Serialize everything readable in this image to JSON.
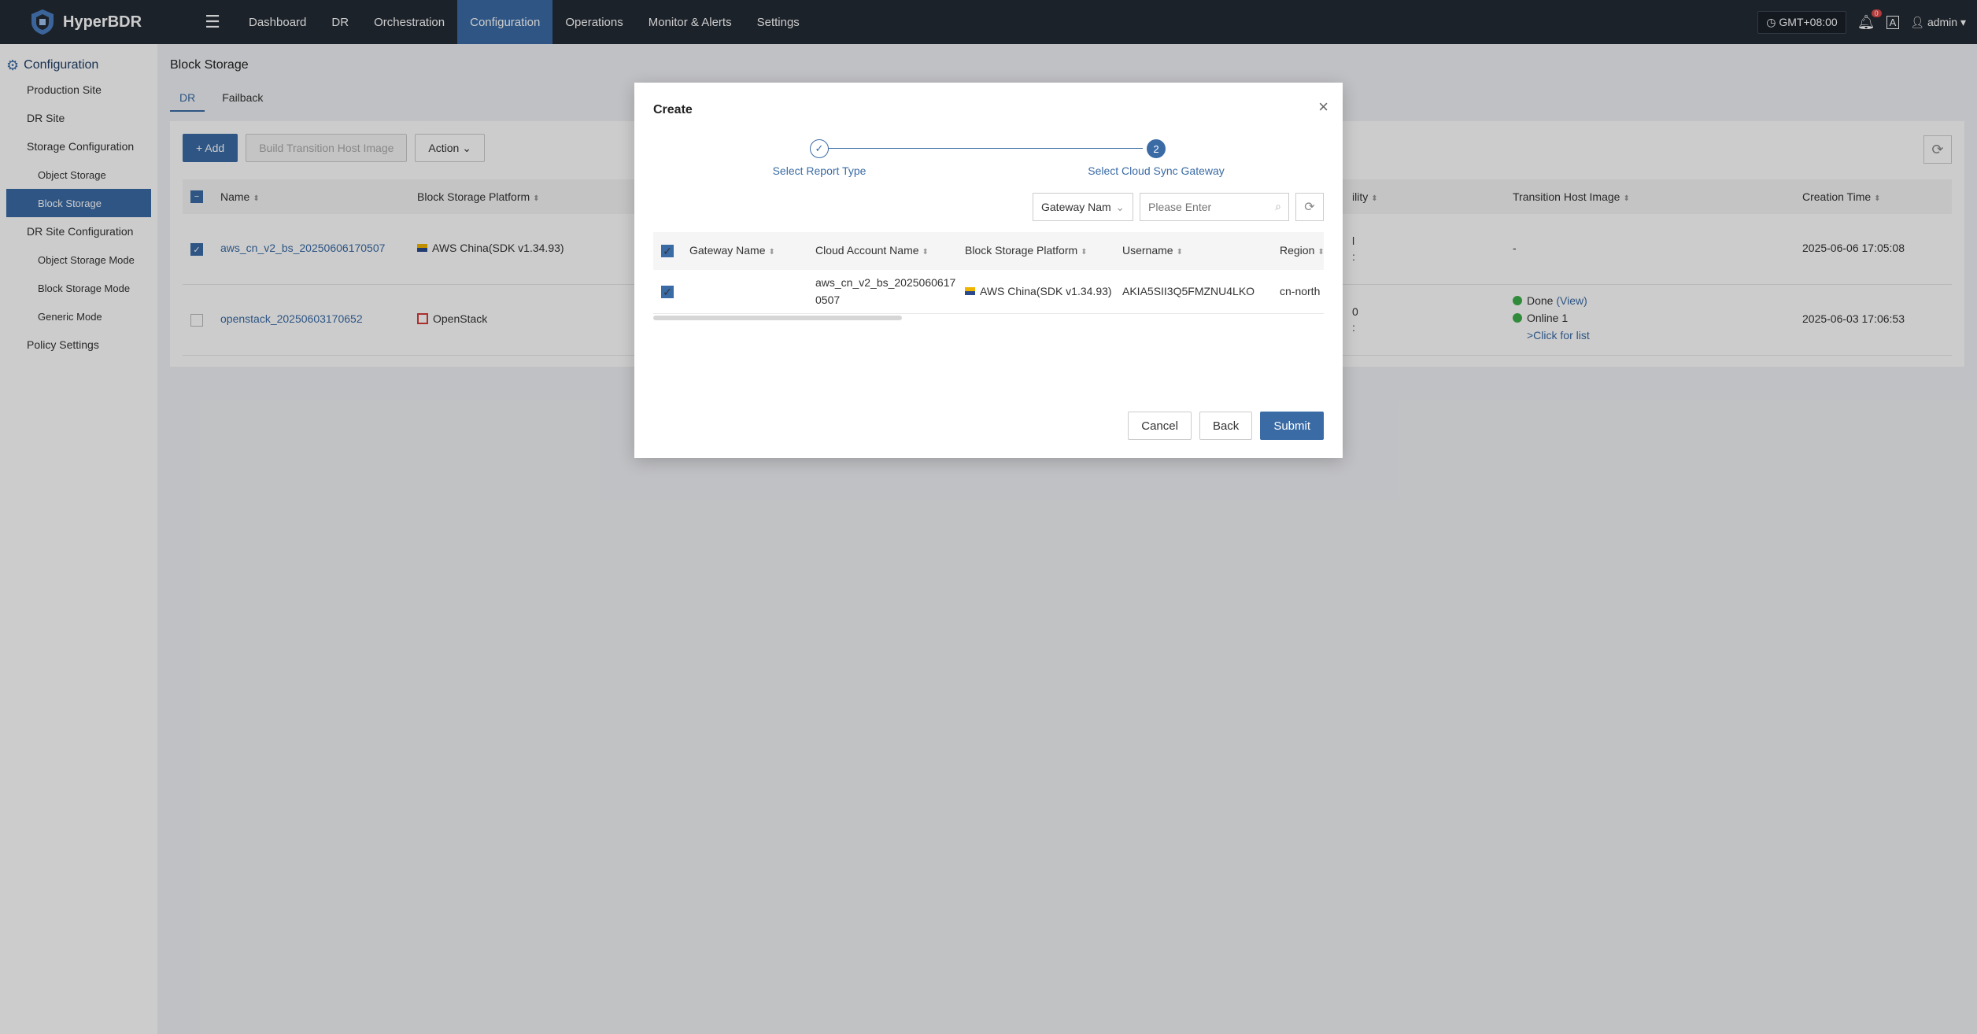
{
  "app": {
    "name": "HyperBDR"
  },
  "nav": [
    {
      "label": "Dashboard"
    },
    {
      "label": "DR"
    },
    {
      "label": "Orchestration"
    },
    {
      "label": "Configuration",
      "active": true
    },
    {
      "label": "Operations"
    },
    {
      "label": "Monitor & Alerts"
    },
    {
      "label": "Settings"
    }
  ],
  "topright": {
    "timezone": "GMT+08:00",
    "bell_count": "0",
    "lang": "A",
    "user": "admin"
  },
  "sidebar": {
    "head": "Configuration",
    "items": [
      {
        "label": "Production Site"
      },
      {
        "label": "DR Site"
      },
      {
        "label": "Storage Configuration"
      },
      {
        "label": "Object Storage"
      },
      {
        "label": "Block Storage"
      },
      {
        "label": "DR Site Configuration"
      },
      {
        "label": "Object Storage Mode"
      },
      {
        "label": "Block Storage Mode"
      },
      {
        "label": "Generic Mode"
      },
      {
        "label": "Policy Settings"
      }
    ]
  },
  "page": {
    "title": "Block Storage",
    "tabs": [
      {
        "label": "DR"
      },
      {
        "label": "Failback"
      }
    ],
    "toolbar": {
      "add": "+ Add",
      "build": "Build Transition Host Image",
      "action": "Action"
    },
    "columns": {
      "name": "Name",
      "platform": "Block Storage Platform",
      "ability": "ility",
      "image": "Transition Host Image",
      "created": "Creation Time"
    },
    "rows": [
      {
        "name": "aws_cn_v2_bs_20250606170507",
        "platform": "AWS China(SDK v1.34.93)",
        "ability_a": "l",
        "ability_b": ":",
        "image": "-",
        "created": "2025-06-06 17:05:08"
      },
      {
        "name": "openstack_20250603170652",
        "platform": "OpenStack",
        "ability_a": "0",
        "ability_b": ":",
        "image_status": "Done",
        "image_view": "(View)",
        "image_online": "Online 1",
        "image_list": ">Click for list",
        "created": "2025-06-03 17:06:53"
      }
    ]
  },
  "modal": {
    "title": "Create",
    "steps": [
      {
        "label": "Select Report Type",
        "mark": "✓"
      },
      {
        "label": "Select Cloud Sync Gateway",
        "mark": "2"
      }
    ],
    "filter": {
      "select_value": "Gateway Nam",
      "placeholder": "Please Enter"
    },
    "columns": {
      "gateway": "Gateway Name",
      "account": "Cloud Account Name",
      "platform": "Block Storage Platform",
      "username": "Username",
      "region": "Region"
    },
    "rows": [
      {
        "gateway": "",
        "account_line1": "aws_cn_v2_bs_2025060617",
        "account_line2": "0507",
        "platform": "AWS China(SDK v1.34.93)",
        "username": "AKIA5SII3Q5FMZNU4LKO",
        "region": "cn-north"
      }
    ],
    "buttons": {
      "cancel": "Cancel",
      "back": "Back",
      "submit": "Submit"
    }
  },
  "colors": {
    "accent": "#3a6ba5",
    "topbar": "#232b35",
    "success": "#3cae4a"
  }
}
